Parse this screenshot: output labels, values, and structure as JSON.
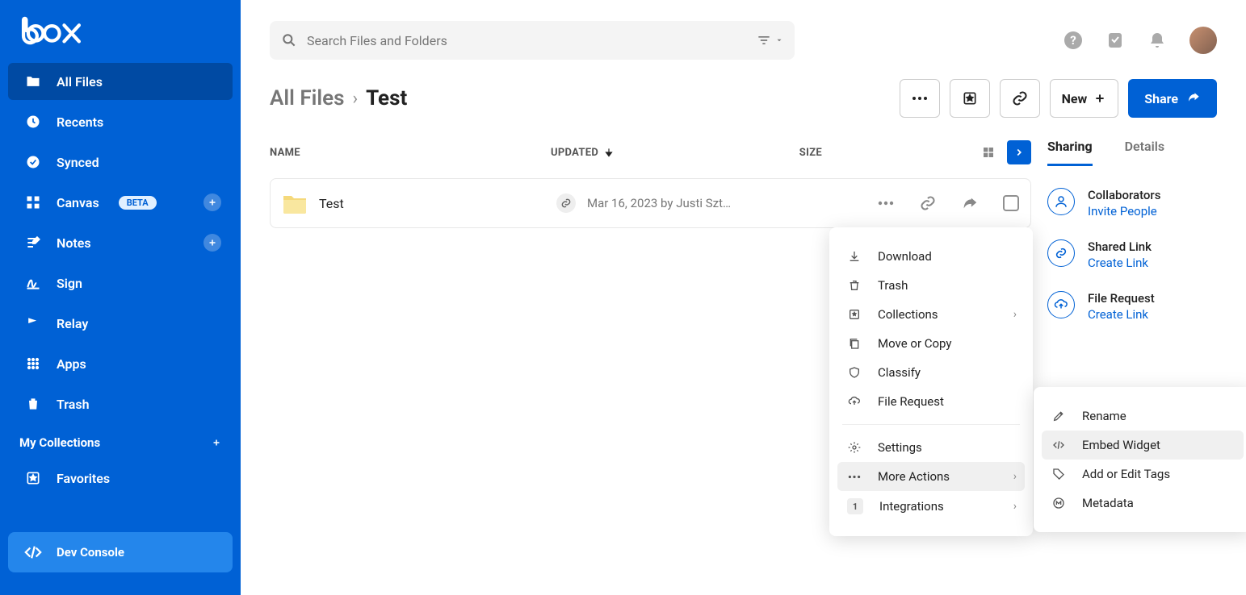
{
  "app_name": "box",
  "sidebar": {
    "items": [
      {
        "key": "all-files",
        "label": "All Files",
        "active": true
      },
      {
        "key": "recents",
        "label": "Recents"
      },
      {
        "key": "synced",
        "label": "Synced"
      },
      {
        "key": "canvas",
        "label": "Canvas",
        "beta": "BETA",
        "plus": true
      },
      {
        "key": "notes",
        "label": "Notes",
        "plus": true
      },
      {
        "key": "sign",
        "label": "Sign"
      },
      {
        "key": "relay",
        "label": "Relay"
      },
      {
        "key": "apps",
        "label": "Apps"
      },
      {
        "key": "trash",
        "label": "Trash"
      }
    ],
    "collections_header": "My Collections",
    "favorites_label": "Favorites",
    "dev_console_label": "Dev Console"
  },
  "search": {
    "placeholder": "Search Files and Folders"
  },
  "breadcrumb": {
    "root": "All Files",
    "current": "Test"
  },
  "toolbar": {
    "new_label": "New",
    "share_label": "Share"
  },
  "columns": {
    "name": "NAME",
    "updated": "UPDATED",
    "size": "SIZE"
  },
  "files": [
    {
      "name": "Test",
      "updated": "Mar 16, 2023 by Justi Szt…"
    }
  ],
  "context_menu": {
    "download": "Download",
    "trash": "Trash",
    "collections": "Collections",
    "move_copy": "Move or Copy",
    "classify": "Classify",
    "file_request": "File Request",
    "settings": "Settings",
    "more_actions": "More Actions",
    "integrations": "Integrations",
    "integrations_count": "1"
  },
  "submenu": {
    "rename": "Rename",
    "embed_widget": "Embed Widget",
    "add_edit_tags": "Add or Edit Tags",
    "metadata": "Metadata"
  },
  "right_panel": {
    "tabs": {
      "sharing": "Sharing",
      "details": "Details"
    },
    "collaborators_label": "Collaborators",
    "invite_people": "Invite People",
    "shared_link_label": "Shared Link",
    "create_link": "Create Link",
    "file_request_label": "File Request",
    "create_link2": "Create Link"
  }
}
